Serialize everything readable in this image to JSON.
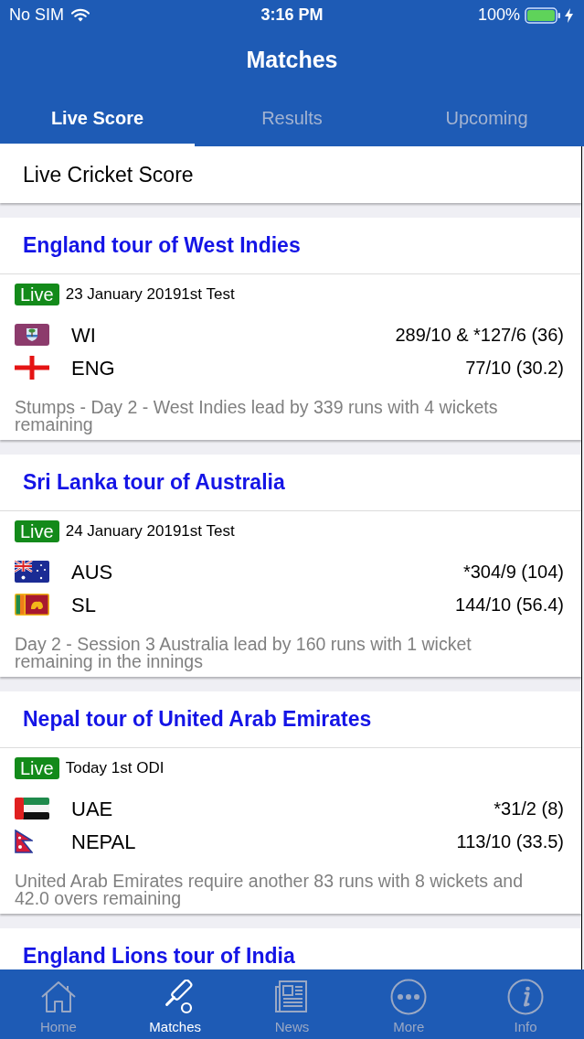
{
  "status_bar": {
    "carrier": "No SIM",
    "time": "3:16 PM",
    "battery": "100%"
  },
  "nav_bar": {
    "title": "Matches"
  },
  "tabs": [
    {
      "label": "Live Score",
      "selected": true
    },
    {
      "label": "Results",
      "selected": false
    },
    {
      "label": "Upcoming",
      "selected": false
    }
  ],
  "section_header": {
    "title": "Live Cricket Score"
  },
  "series": [
    {
      "title": "England tour of West Indies",
      "match": {
        "badge": "Live",
        "info": "23 January 20191st Test",
        "teams": [
          {
            "kind": "windies",
            "name": "WI",
            "score": "289/10 & *127/6 (36)"
          },
          {
            "kind": "england",
            "name": "ENG",
            "score": "77/10 (30.2)"
          }
        ],
        "status": "Stumps - Day 2 - West Indies lead by 339 runs with 4 wickets remaining"
      }
    },
    {
      "title": "Sri Lanka tour of Australia",
      "match": {
        "badge": "Live",
        "info": "24 January 20191st Test",
        "teams": [
          {
            "kind": "australia",
            "name": "AUS",
            "score": "*304/9 (104)"
          },
          {
            "kind": "srilanka",
            "name": "SL",
            "score": "144/10 (56.4)"
          }
        ],
        "status": "Day 2 - Session 3 Australia lead by 160 runs with 1 wicket remaining in the innings"
      }
    },
    {
      "title": "Nepal tour of United Arab Emirates",
      "match": {
        "badge": "Live",
        "info": "Today 1st ODI",
        "teams": [
          {
            "kind": "uae",
            "name": "UAE",
            "score": "*31/2 (8)"
          },
          {
            "kind": "nepal",
            "name": "NEPAL",
            "score": "113/10 (33.5)"
          }
        ],
        "status": "United Arab Emirates require another 83 runs with 8 wickets and 42.0 overs remaining"
      }
    },
    {
      "title": "England Lions tour of India"
    }
  ],
  "tab_bar": [
    {
      "kind": "home",
      "label": "Home",
      "selected": false
    },
    {
      "kind": "matches",
      "label": "Matches",
      "selected": true
    },
    {
      "kind": "news",
      "label": "News",
      "selected": false
    },
    {
      "kind": "more",
      "label": "More",
      "selected": false
    },
    {
      "kind": "info",
      "label": "Info",
      "selected": false
    }
  ]
}
